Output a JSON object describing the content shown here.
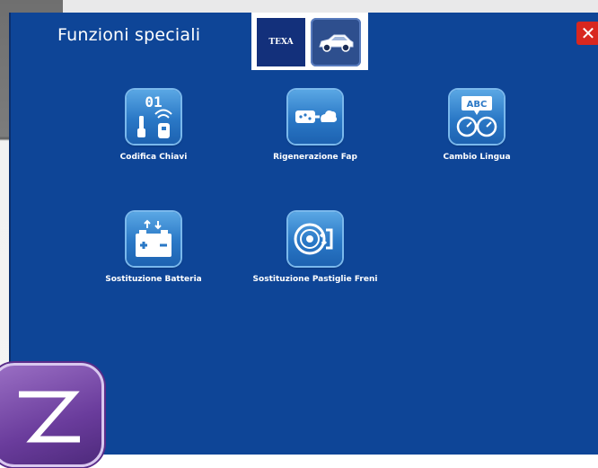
{
  "dialog": {
    "title": "Funzioni speciali",
    "brand_logo_text": "TEXA",
    "close_label": "✕"
  },
  "functions": [
    {
      "label": "Codifica Chiavi",
      "icon": "key-coding-icon",
      "icon_text": "01"
    },
    {
      "label": "Rigenerazione Fap",
      "icon": "dpf-regeneration-icon"
    },
    {
      "label": "Cambio Lingua",
      "icon": "language-change-icon",
      "icon_text": "ABC"
    },
    {
      "label": "Sostituzione Batteria",
      "icon": "battery-replacement-icon"
    },
    {
      "label": "Sostituzione Pastiglie Freni",
      "icon": "brake-pads-icon"
    }
  ],
  "colors": {
    "dialog_bg": "#0e4597",
    "icon_blue": "#2a78c6",
    "close_red": "#d8271f",
    "app_logo_purple": "#6a3c9c"
  }
}
